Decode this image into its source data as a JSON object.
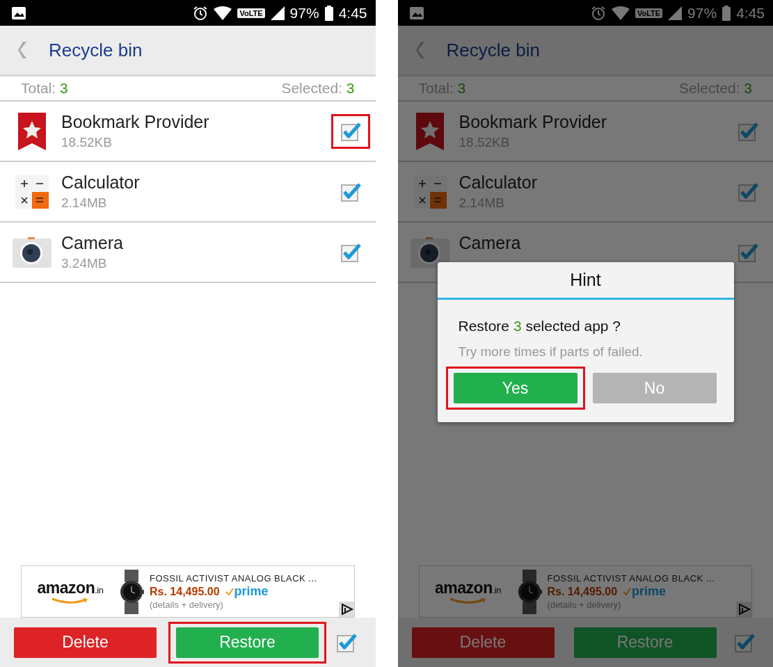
{
  "screens": [
    {
      "status_bar": {
        "network_badge": "VoLTE",
        "battery": "97%",
        "time": "4:45"
      },
      "title": "Recycle bin",
      "total_label": "Total: ",
      "total_value": "3",
      "selected_label": "Selected: ",
      "selected_value": "3",
      "apps": [
        {
          "kind": "bookmark",
          "name": "Bookmark Provider",
          "size": "18.52KB",
          "checked": true,
          "highlighted": true
        },
        {
          "kind": "calculator",
          "name": "Calculator",
          "size": "2.14MB",
          "checked": true,
          "highlighted": false
        },
        {
          "kind": "camera",
          "name": "Camera",
          "size": "3.24MB",
          "checked": true,
          "highlighted": false
        }
      ],
      "ad": {
        "logo": "amazon",
        "logo_suffix": ".in",
        "product": "FOSSIL ACTIVIST ANALOG BLACK ...",
        "price": "Rs. 14,495.00",
        "badge": "prime",
        "note": "(details + delivery)"
      },
      "delete_button": {
        "label": "Delete"
      },
      "restore_button": {
        "label": "Restore",
        "highlighted": true
      },
      "select_all": {
        "checked": true
      }
    },
    {
      "status_bar": {
        "network_badge": "VoLTE",
        "battery": "97%",
        "time": "4:45"
      },
      "title": "Recycle bin",
      "total_label": "Total: ",
      "total_value": "3",
      "selected_label": "Selected: ",
      "selected_value": "3",
      "apps": [
        {
          "kind": "bookmark",
          "name": "Bookmark Provider",
          "size": "18.52KB",
          "checked": true,
          "highlighted": false
        },
        {
          "kind": "calculator",
          "name": "Calculator",
          "size": "2.14MB",
          "checked": true,
          "highlighted": false
        },
        {
          "kind": "camera",
          "name": "Camera",
          "checked": true,
          "highlighted": false
        }
      ],
      "ad": {
        "logo": "amazon",
        "logo_suffix": ".in",
        "product": "FOSSIL ACTIVIST ANALOG BLACK ...",
        "price": "Rs. 14,495.00",
        "badge": "prime",
        "note": "(details + delivery)"
      },
      "delete_button": {
        "label": "Delete"
      },
      "restore_button": {
        "label": "Restore",
        "highlighted": false
      },
      "select_all": {
        "checked": true
      },
      "dialog": {
        "title": "Hint",
        "message_start": "Restore ",
        "message_count": "3",
        "message_end": " selected app ?",
        "hint": "Try more times if parts of failed.",
        "yes": {
          "label": "Yes",
          "highlighted": true
        },
        "no": {
          "label": "No",
          "highlighted": false
        }
      }
    }
  ]
}
